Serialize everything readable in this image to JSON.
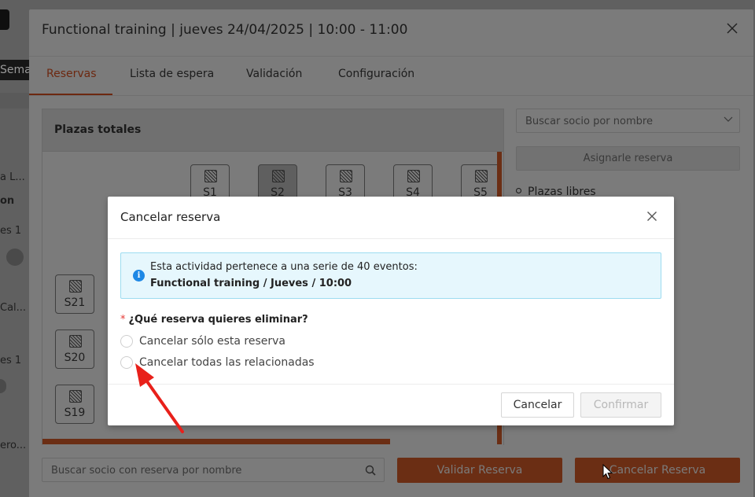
{
  "background": {
    "week_label": "Sema",
    "left_texts": [
      "a L...",
      "on",
      "es 1",
      "Cal...",
      "es 1",
      "ero..."
    ]
  },
  "modal": {
    "title": "Functional training | jueves 24/04/2025 | 10:00 - 11:00",
    "tabs": [
      {
        "label": "Reservas",
        "active": true
      },
      {
        "label": "Lista de espera",
        "active": false
      },
      {
        "label": "Validación",
        "active": false
      },
      {
        "label": "Configuración",
        "active": false
      }
    ],
    "panel_title": "Plazas totales",
    "seats_top": [
      "S1",
      "S2",
      "S3",
      "S4",
      "S5"
    ],
    "seats_left": [
      "S21",
      "S20",
      "S19"
    ],
    "search_socio_placeholder": "Buscar socio por nombre",
    "assign_button": "Asignarle reserva",
    "legend_free": "Plazas libres",
    "search_reserva_placeholder": "Buscar socio con reserva por nombre",
    "validate_button": "Validar Reserva",
    "cancel_reservation_button": "Cancelar Reserva"
  },
  "dialog": {
    "title": "Cancelar reserva",
    "info_line1": "Esta actividad pertenece a una serie de 40 eventos:",
    "info_line2": "Functional training / Jueves / 10:00",
    "question": "¿Qué reserva quieres eliminar?",
    "options": [
      {
        "label": "Cancelar sólo esta reserva",
        "selected": false
      },
      {
        "label": "Cancelar todas las relacionadas",
        "selected": false
      }
    ],
    "cancel_button": "Cancelar",
    "confirm_button": "Confirmar"
  },
  "colors": {
    "accent": "#c0400b",
    "info_bg": "#e6f7fd",
    "info_border": "#9edcf0",
    "info_icon": "#1e88e5",
    "required": "#e53935",
    "annotation_arrow": "#e8201a"
  }
}
